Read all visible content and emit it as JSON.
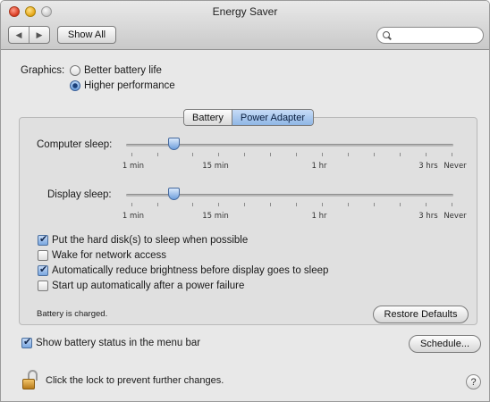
{
  "window": {
    "title": "Energy Saver",
    "toolbar": {
      "back_icon": "◀",
      "forward_icon": "▶",
      "show_all": "Show All",
      "search_value": ""
    }
  },
  "graphics": {
    "label": "Graphics:",
    "options": [
      {
        "label": "Better battery life",
        "selected": false
      },
      {
        "label": "Higher performance",
        "selected": true
      }
    ]
  },
  "tabs": [
    {
      "label": "Battery",
      "selected": false
    },
    {
      "label": "Power Adapter",
      "selected": true
    }
  ],
  "sliders": {
    "computer_sleep": {
      "label": "Computer sleep:",
      "value": "10 min"
    },
    "display_sleep": {
      "label": "Display sleep:",
      "value": "10 min"
    },
    "tick_labels": [
      "1 min",
      "15 min",
      "1 hr",
      "3 hrs",
      "Never"
    ]
  },
  "options": [
    {
      "label": "Put the hard disk(s) to sleep when possible",
      "checked": true
    },
    {
      "label": "Wake for network access",
      "checked": false
    },
    {
      "label": "Automatically reduce brightness before display goes to sleep",
      "checked": true
    },
    {
      "label": "Start up automatically after a power failure",
      "checked": false
    }
  ],
  "status_text": "Battery is charged.",
  "restore_defaults": "Restore Defaults",
  "show_battery_status": {
    "label": "Show battery status in the menu bar",
    "checked": true
  },
  "schedule": "Schedule...",
  "lock_text": "Click the lock to prevent further changes.",
  "help": "?"
}
